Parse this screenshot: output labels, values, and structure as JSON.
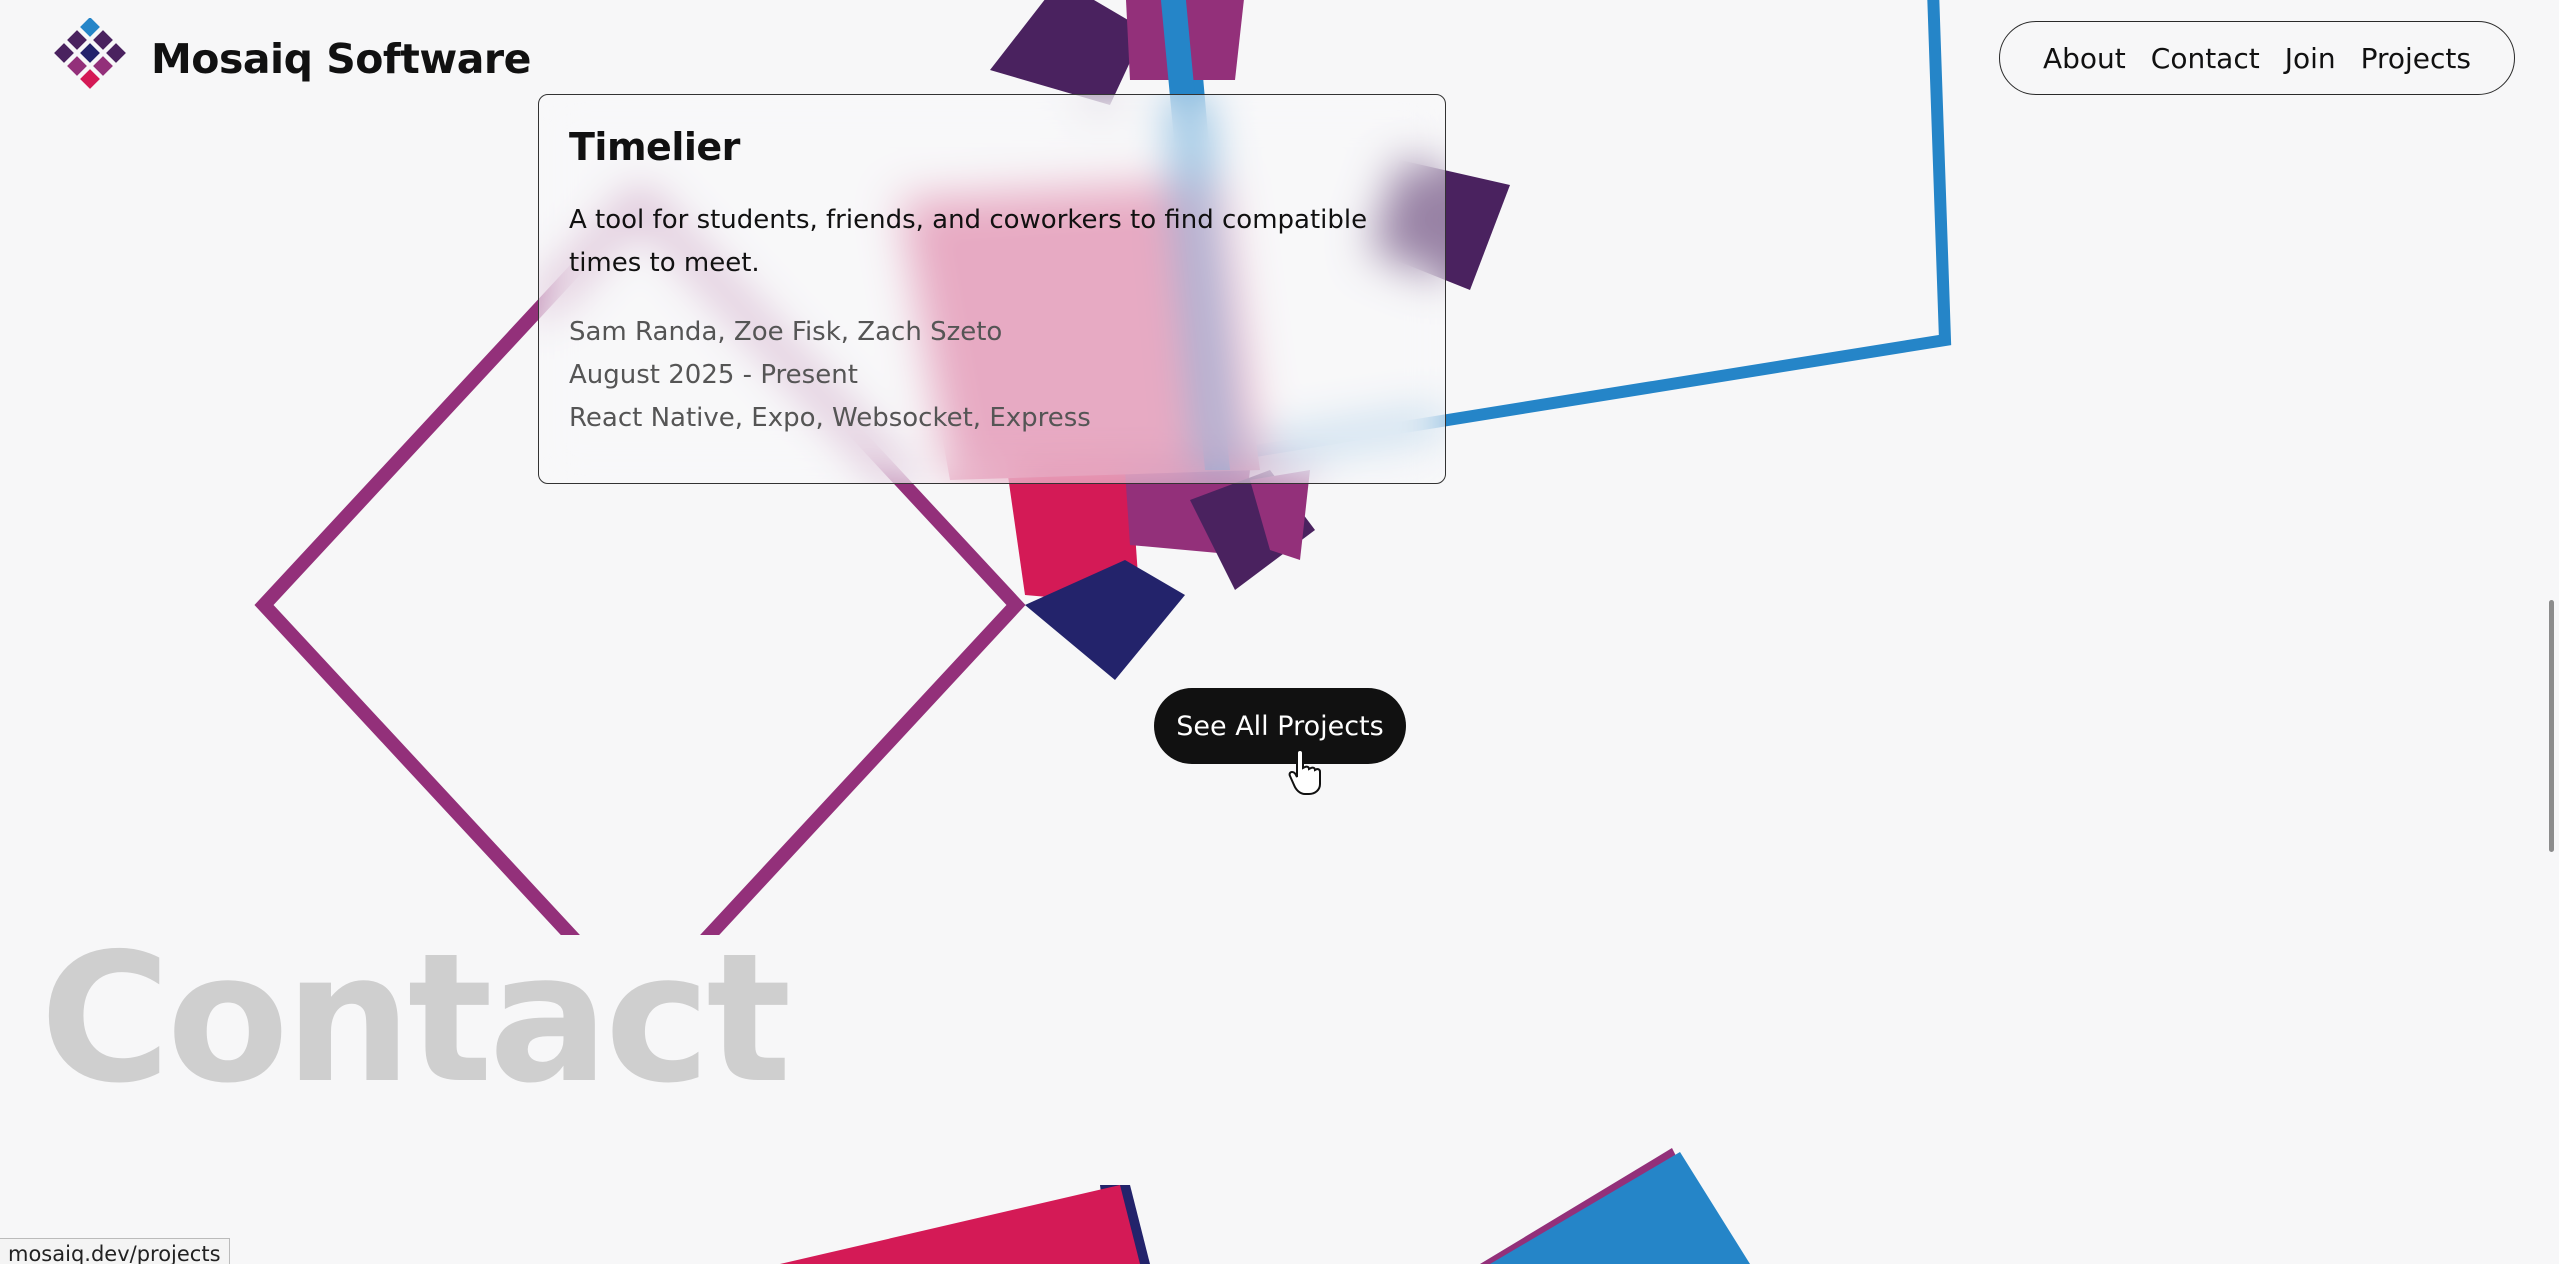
{
  "brand": {
    "name": "Mosaiq Software",
    "logo_icon": "mosaic-diamond-logo"
  },
  "nav": {
    "items": [
      {
        "label": "About"
      },
      {
        "label": "Contact"
      },
      {
        "label": "Join"
      },
      {
        "label": "Projects"
      }
    ]
  },
  "project_card": {
    "title": "Timelier",
    "description": "A tool for students, friends, and coworkers to find compatible times to meet.",
    "team": "Sam Randa, Zoe Fisk, Zach Szeto",
    "dates": "August 2025 - Present",
    "stack": "React Native, Expo, Websocket, Express"
  },
  "cta": {
    "label": "See All Projects"
  },
  "section": {
    "heading": "Contact"
  },
  "status_bar": {
    "url": "mosaiq.dev/projects"
  },
  "colors": {
    "background": "#f7f7f8",
    "purple": "#93307a",
    "deep_purple": "#4a225f",
    "crimson": "#d41a56",
    "navy": "#23236b",
    "blue": "#2585c8",
    "heading_gray": "#cfcfcf"
  }
}
